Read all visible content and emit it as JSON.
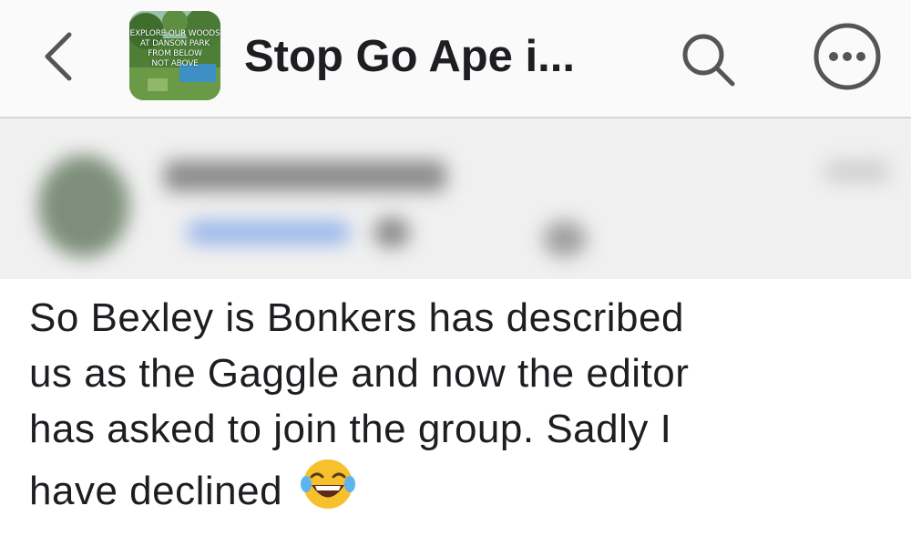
{
  "header": {
    "title": "Stop Go Ape i...",
    "thumbnail_caption_lines": [
      "EXPLORE OUR WOODS",
      "AT DANSON PARK",
      "FROM BELOW",
      "NOT ABOVE"
    ]
  },
  "icons": {
    "back": "chevron-left-icon",
    "search": "search-icon",
    "more": "more-horizontal-icon",
    "reaction": "laughing-tears-emoji"
  },
  "post": {
    "lines": [
      "So Bexley is Bonkers has described",
      "us as the Gaggle and now the editor",
      "has asked to join the group. Sadly I",
      "have declined"
    ]
  },
  "colors": {
    "header_bg": "#fafafa",
    "text": "#1c1e21",
    "icon": "#555555",
    "divider": "#d6d6d6"
  }
}
